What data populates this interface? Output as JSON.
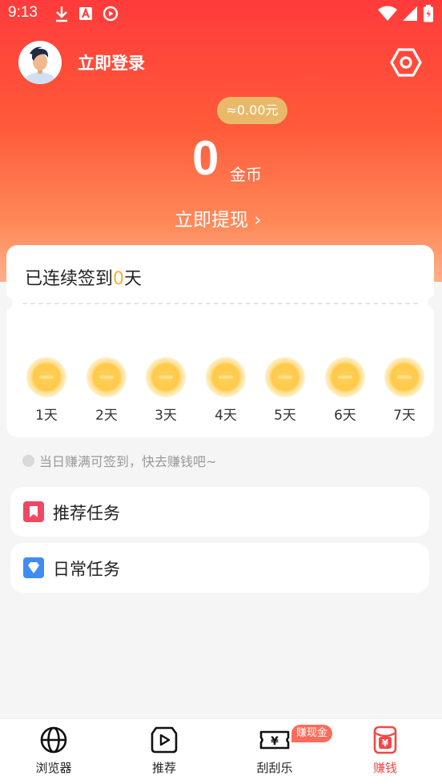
{
  "status_bar": {
    "time": "9:13",
    "left_icons": [
      "download-icon",
      "a-icon",
      "play-circle-icon"
    ],
    "right_icons": [
      "wifi-icon",
      "signal-icon",
      "battery-icon"
    ]
  },
  "header": {
    "login_text": "立即登录",
    "rmb_value": "≈0.00元",
    "coin_amount": "0",
    "coin_unit": "金币",
    "withdraw_text": "立即提现 ›"
  },
  "checkin": {
    "title_prefix": "已连续签到",
    "days_count": "0",
    "title_suffix": "天",
    "days": [
      "1天",
      "2天",
      "3天",
      "4天",
      "5天",
      "6天",
      "7天"
    ]
  },
  "hint": "当日赚满可签到，快去赚钱吧~",
  "tasks": [
    {
      "label": "推荐任务",
      "icon": "bookmark-icon",
      "color": "#f04860"
    },
    {
      "label": "日常任务",
      "icon": "diamond-icon",
      "color": "#3f8cf5"
    }
  ],
  "tabbar": {
    "tabs": [
      {
        "label": "浏览器",
        "icon": "globe-icon"
      },
      {
        "label": "推荐",
        "icon": "video-play-icon"
      },
      {
        "label": "刮刮乐",
        "icon": "ticket-icon"
      },
      {
        "label": "赚钱",
        "icon": "red-packet-icon"
      }
    ],
    "badge": "赚现金",
    "active_color": "#f04848"
  }
}
